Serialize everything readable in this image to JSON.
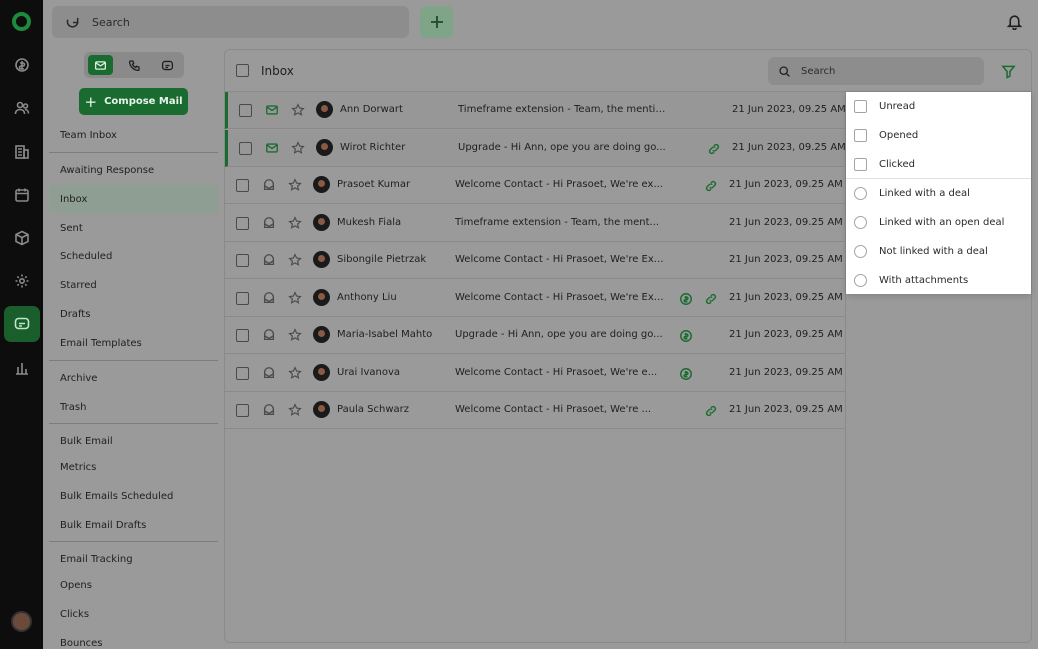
{
  "topbar": {
    "search_placeholder": "Search"
  },
  "compose_label": "Compose Mail",
  "sidebar": {
    "items": [
      {
        "label": "Team Inbox"
      },
      {
        "label": "Awaiting Response"
      },
      {
        "label": "Inbox"
      },
      {
        "label": "Sent"
      },
      {
        "label": "Scheduled"
      },
      {
        "label": "Starred"
      },
      {
        "label": "Drafts"
      },
      {
        "label": "Email Templates"
      },
      {
        "label": "Archive"
      },
      {
        "label": "Trash"
      },
      {
        "label": "Bulk Email"
      },
      {
        "label": "Metrics"
      },
      {
        "label": "Bulk Emails Scheduled"
      },
      {
        "label": "Bulk Email Drafts"
      },
      {
        "label": "Email Tracking"
      },
      {
        "label": "Opens"
      },
      {
        "label": "Clicks"
      },
      {
        "label": "Bounces"
      }
    ],
    "selected": "Inbox"
  },
  "main": {
    "title": "Inbox",
    "search_placeholder": "Search"
  },
  "emails": [
    {
      "name": "Ann Dorwart",
      "subject": "Timeframe extension  -  Team, the mentio...",
      "date": "21 Jun 2023, 09.25 AM",
      "opened": true,
      "deal": false,
      "tracked": false
    },
    {
      "name": "Wirot Richter",
      "subject": "Upgrade  -  Hi Ann, ope you are doing go...",
      "date": "21 Jun 2023, 09.25 AM",
      "opened": true,
      "deal": false,
      "tracked": true
    },
    {
      "name": "Prasoet Kumar",
      "subject": "Welcome Contact  -  Hi Prasoet, We're ex...",
      "date": "21 Jun 2023, 09.25 AM",
      "opened": false,
      "deal": false,
      "tracked": true
    },
    {
      "name": "Mukesh Fiala",
      "subject": "Timeframe extension  -  Team, the ment...",
      "date": "21 Jun 2023, 09.25 AM",
      "opened": false,
      "deal": false,
      "tracked": false
    },
    {
      "name": "Sibongile Pietrzak",
      "subject": "Welcome Contact  -  Hi Prasoet, We're Exc...",
      "date": "21 Jun 2023, 09.25 AM",
      "opened": false,
      "deal": false,
      "tracked": false
    },
    {
      "name": "Anthony Liu",
      "subject": "Welcome Contact  -  Hi Prasoet, We're Exc...",
      "date": "21 Jun 2023, 09.25 AM",
      "opened": false,
      "deal": true,
      "tracked": true
    },
    {
      "name": "Maria-Isabel Mahto",
      "subject": "Upgrade  -  Hi Ann, ope you are doing go...",
      "date": "21 Jun 2023, 09.25 AM",
      "opened": false,
      "deal": true,
      "tracked": false
    },
    {
      "name": "Urai Ivanova",
      "subject": "Welcome Contact  -  Hi Prasoet, We're e...",
      "date": "21 Jun 2023, 09.25 AM",
      "opened": false,
      "deal": true,
      "tracked": false
    },
    {
      "name": "Paula Schwarz",
      "subject": "Welcome Contact  -  Hi Prasoet, We're ...",
      "date": "21 Jun 2023, 09.25 AM",
      "opened": false,
      "deal": false,
      "tracked": true
    }
  ],
  "filter_menu": {
    "checkbox_options": [
      "Unread",
      "Opened",
      "Clicked"
    ],
    "radio_options": [
      "Linked with a deal",
      "Linked with an open deal",
      "Not linked with a deal",
      "With attachments"
    ]
  },
  "colors": {
    "brand_green": "#1a6b30",
    "overlay_gray": "#9a9a9a",
    "rail_black": "#0d0d0d"
  }
}
